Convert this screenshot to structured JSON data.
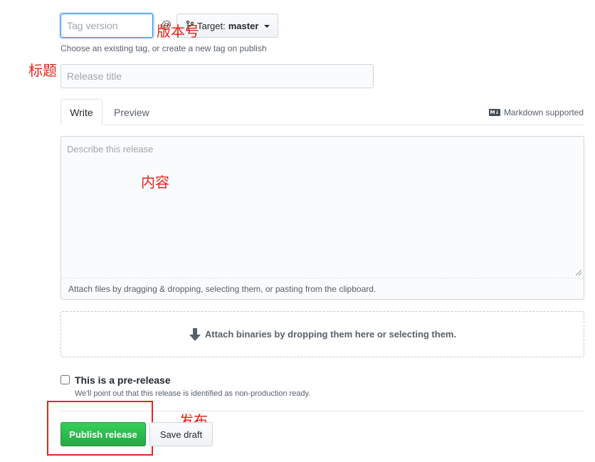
{
  "tag": {
    "placeholder": "Tag version",
    "at_symbol": "@",
    "target_prefix": "Target:",
    "target_branch": "master",
    "hint": "Choose an existing tag, or create a new tag on publish"
  },
  "title": {
    "placeholder": "Release title"
  },
  "editor": {
    "tabs": [
      "Write",
      "Preview"
    ],
    "markdown_note": "Markdown supported",
    "placeholder": "Describe this release",
    "attach_hint": "Attach files by dragging & dropping, selecting them, or pasting from the clipboard."
  },
  "binaries": {
    "label": "Attach binaries by dropping them here or selecting them."
  },
  "prerelease": {
    "label": "This is a pre-release",
    "note": "We'll point out that this release is identified as non-production ready.",
    "checked": false
  },
  "actions": {
    "publish": "Publish release",
    "save_draft": "Save draft"
  },
  "annotations": {
    "version": "版本号",
    "title": "标题",
    "content": "内容",
    "publish": "发布"
  },
  "colors": {
    "annotation": "#e2261c",
    "publish_green": "#28a745",
    "focus_blue": "#2188ff"
  }
}
